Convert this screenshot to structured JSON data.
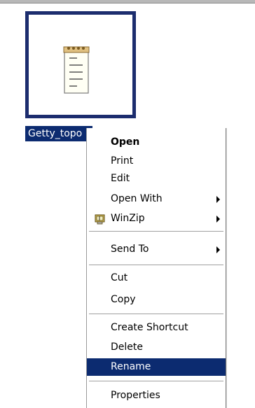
{
  "desktop": {
    "file_label": "Getty_topo",
    "file_icon": "notepad-icon"
  },
  "context_menu": {
    "items": [
      {
        "label": "Open"
      },
      {
        "label": "Print"
      },
      {
        "label": "Edit"
      },
      {
        "label": "Open With"
      },
      {
        "label": "WinZip",
        "icon": "winzip-icon"
      },
      {
        "label": "Send To"
      },
      {
        "label": "Cut"
      },
      {
        "label": "Copy"
      },
      {
        "label": "Create Shortcut"
      },
      {
        "label": "Delete"
      },
      {
        "label": "Rename"
      },
      {
        "label": "Properties"
      }
    ],
    "selected": "Rename"
  },
  "colors": {
    "selection": "#0c2b70",
    "tile_border": "#1c2d6e"
  }
}
